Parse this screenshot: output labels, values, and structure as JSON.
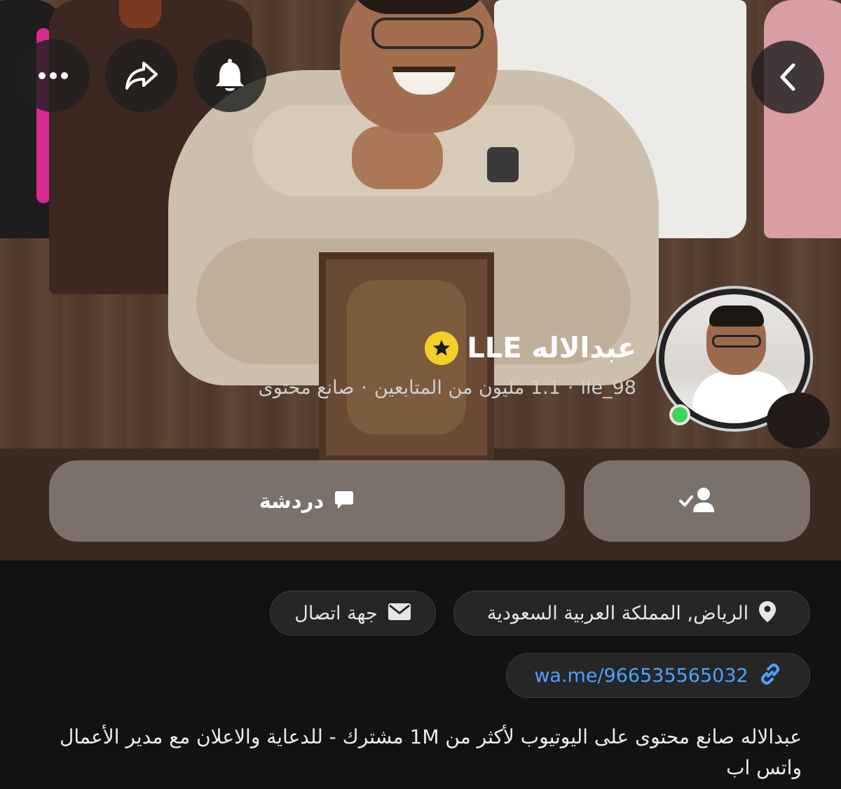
{
  "profile": {
    "display_name": "عبدالاله LLE",
    "username": "lle_98",
    "followers": "1.1 مليون من المتابعين",
    "category": "صانع محتوى",
    "online": true
  },
  "actions": {
    "chat_label": "دردشة"
  },
  "info": {
    "location": "الرياض, المملكة العربية السعودية",
    "contact_label": "جهة اتصال",
    "link": "wa.me/966535565032"
  },
  "bio": "عبدالاله صانع محتوى على اليوتيوب لأكثر من 1M مشترك - للدعاية والاعلان مع مدير الأعمال واتس اب",
  "icons": {
    "back": "chevron-left-icon",
    "notifications": "bell-icon",
    "share": "share-arrow-icon",
    "more": "more-dots-icon",
    "verified": "star-badge-icon",
    "chat": "chat-bubble-icon",
    "friend_added": "user-check-icon",
    "location": "location-pin-icon",
    "contact": "envelope-icon",
    "link": "link-icon"
  },
  "colors": {
    "background": "#121212",
    "badge_yellow": "#f2d027",
    "online_green": "#3fd45b",
    "link_blue": "#4aa3ff"
  }
}
